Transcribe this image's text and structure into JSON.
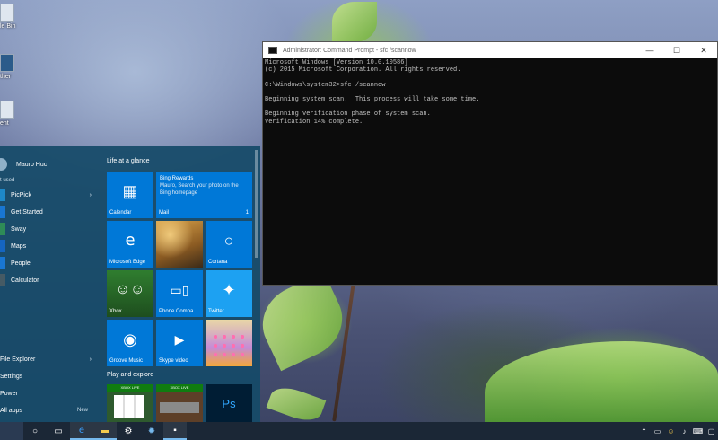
{
  "desktop": {
    "icons": [
      {
        "label": "le Bin",
        "icon": "recycle-bin-icon"
      },
      {
        "label": "ther",
        "icon": "shortcut-icon"
      },
      {
        "label": "ent",
        "icon": "document-icon"
      }
    ]
  },
  "start_menu": {
    "user_name": "Mauro Huc",
    "most_used_label": "t used",
    "apps": [
      {
        "label": "PicPick",
        "color": "#1e88c8",
        "has_arrow": true
      },
      {
        "label": "Get Started",
        "color": "#1976d2",
        "has_arrow": false
      },
      {
        "label": "Sway",
        "color": "#2e8b57",
        "has_arrow": false
      },
      {
        "label": "Maps",
        "color": "#1565c0",
        "has_arrow": false
      },
      {
        "label": "People",
        "color": "#1976d2",
        "has_arrow": false
      },
      {
        "label": "Calculator",
        "color": "#455a64",
        "has_arrow": false
      }
    ],
    "bottom": {
      "file_explorer": "File Explorer",
      "settings": "Settings",
      "power": "Power",
      "all_apps": "All apps",
      "new_badge": "New"
    },
    "groups": {
      "life": "Life at a glance",
      "play": "Play and explore"
    },
    "tiles": {
      "calendar": "Calendar",
      "bing_title": "Bing Rewards",
      "bing_text": "Mauro, Search your photo on the Bing homepage",
      "mail": "Mail",
      "mail_count": "1",
      "edge": "Microsoft Edge",
      "cortana": "Cortana",
      "xbox": "Xbox",
      "phone": "Phone Compa...",
      "twitter": "Twitter",
      "groove": "Groove Music",
      "skype": "Skype video",
      "xbox_live": "XBOX LIVE",
      "photoshop": "Ps"
    }
  },
  "cmd": {
    "title": "Administrator: Command Prompt - sfc /scannow",
    "lines": [
      "Microsoft Windows [Version 10.0.10586]",
      "(c) 2015 Microsoft Corporation. All rights reserved.",
      "",
      "C:\\Windows\\system32>sfc /scannow",
      "",
      "Beginning system scan.  This process will take some time.",
      "",
      "Beginning verification phase of system scan.",
      "Verification 14% complete."
    ],
    "minimize": "—",
    "maximize": "☐",
    "close": "✕"
  },
  "taskbar": {
    "items": [
      "cortana-circle-icon",
      "task-view-icon",
      "edge-icon",
      "file-explorer-icon",
      "settings-icon",
      "sun-icon",
      "cmd-icon"
    ],
    "tray": [
      "chevron-up-icon",
      "network-icon",
      "emoji-icon",
      "volume-icon",
      "keyboard-icon",
      "notification-icon"
    ]
  },
  "colors": {
    "start_bg": "#164a68",
    "tile_blue": "#0078d7",
    "taskbar": "#1b2736",
    "accent": "#76b9ed"
  }
}
